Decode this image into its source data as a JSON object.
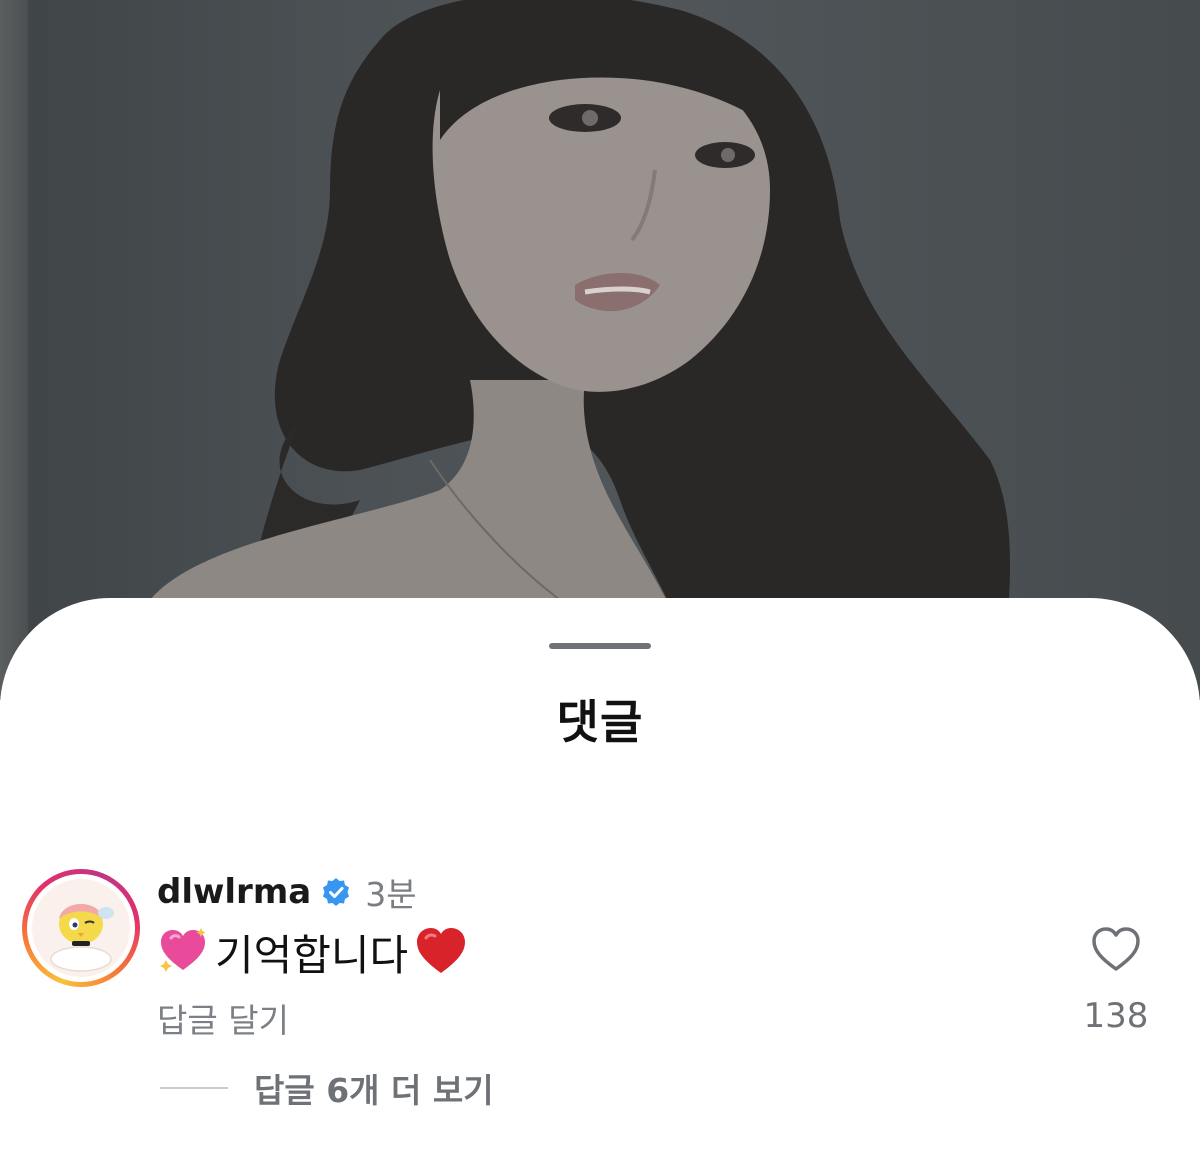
{
  "sheet": {
    "title": "댓글"
  },
  "comment": {
    "username": "dlwlrma",
    "verified": true,
    "time": "3분",
    "text": "기억합니다",
    "leading_emoji": "sparkling-heart",
    "trailing_emoji": "red-heart",
    "reply_label": "답글 달기",
    "like_count": "138",
    "view_replies_label": "답글 6개 더 보기"
  },
  "colors": {
    "verified_badge": "#3797f0",
    "secondary_text": "#7a7d82",
    "primary_text": "#111111"
  }
}
